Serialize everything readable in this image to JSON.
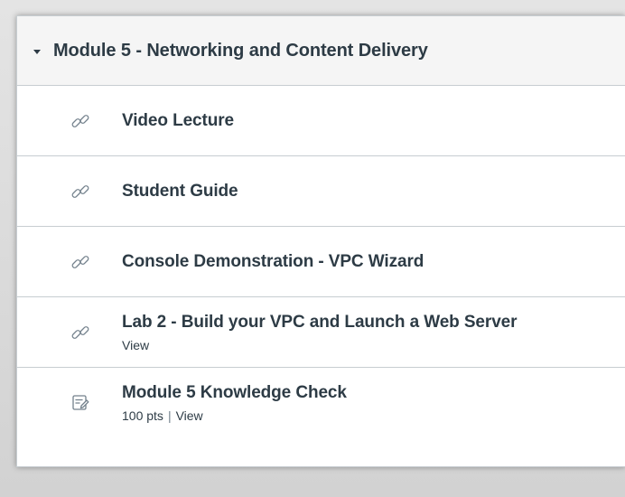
{
  "module": {
    "title": "Module 5 - Networking and Content Delivery",
    "expanded_icon": "caret-down-icon",
    "items": [
      {
        "title": "Video Lecture",
        "icon": "link-icon"
      },
      {
        "title": "Student Guide",
        "icon": "link-icon"
      },
      {
        "title": "Console Demonstration - VPC Wizard",
        "icon": "link-icon"
      },
      {
        "title": "Lab 2 - Build your VPC and Launch a Web Server",
        "icon": "link-icon",
        "sub_view": "View"
      },
      {
        "title": "Module 5 Knowledge Check",
        "icon": "quiz-icon",
        "sub_points": "100 pts",
        "sub_separator": "|",
        "sub_view": "View"
      }
    ]
  },
  "colors": {
    "text": "#2d3b45",
    "border": "#c7cdd1",
    "header_bg": "#f5f5f5",
    "icon": "#73818c"
  }
}
